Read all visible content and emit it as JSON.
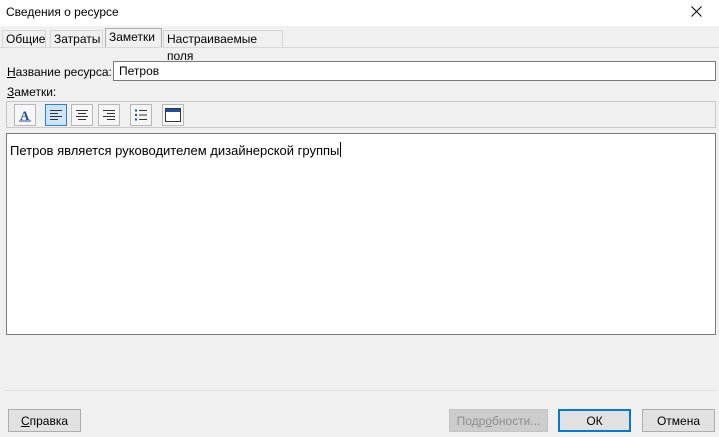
{
  "window": {
    "title": "Сведения о ресурсе",
    "close_icon": "close-icon"
  },
  "tabs": [
    {
      "label": "Общие",
      "active": false
    },
    {
      "label": "Затраты",
      "active": false
    },
    {
      "label": "Заметки",
      "active": true
    },
    {
      "label": "Настраиваемые поля",
      "active": false
    }
  ],
  "resource_name": {
    "label": "Название ресурса:",
    "value": "Петров"
  },
  "notes": {
    "label": "Заметки:",
    "text": "Петров является руководителем дизайнерской группы",
    "toolbar": [
      {
        "icon": "font-icon",
        "pressed": false
      },
      {
        "icon": "align-left-icon",
        "pressed": true
      },
      {
        "icon": "align-center-icon",
        "pressed": false
      },
      {
        "icon": "align-right-icon",
        "pressed": false
      },
      {
        "icon": "bullets-icon",
        "pressed": false
      },
      {
        "icon": "insert-object-icon",
        "pressed": false
      }
    ]
  },
  "buttons": {
    "help": "Справка",
    "details": "Подробности...",
    "ok": "ОК",
    "cancel": "Отмена"
  },
  "colors": {
    "accent": "#0078d7",
    "background": "#f0f0f0"
  }
}
